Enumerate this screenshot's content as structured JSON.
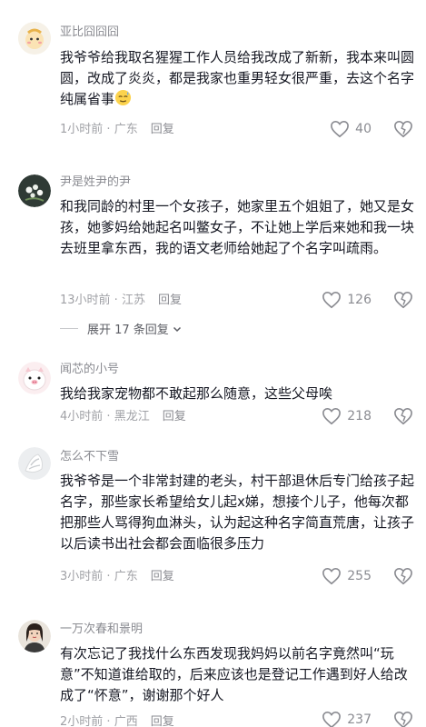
{
  "comments": [
    {
      "username": "亚比囧囧囧",
      "text": "我爷爷给我取名猩猩工作人员给我改成了新新，我本来叫圆圆，改成了炎炎，都是我家也重男轻女很严重，去这个名字纯属省事",
      "emoji": "sweat-smile-emoji",
      "time": "1小时前",
      "location": "广东",
      "reply": "回复",
      "likes": "40"
    },
    {
      "username": "尹是姓尹的尹",
      "text": "和我同龄的村里一个女孩子，她家里五个姐姐了，她又是女孩，她爹妈给她起名叫鳖女子，不让她上学后来她和我一块去班里拿东西，我的语文老师给她起了个名字叫疏雨。",
      "time": "13小时前",
      "location": "江苏",
      "reply": "回复",
      "likes": "126",
      "expand": "展开 17 条回复"
    },
    {
      "username": "闻芯的小号",
      "text": "我给我家宠物都不敢起那么随意，这些父母唉",
      "time": "4小时前",
      "location": "黑龙江",
      "reply": "回复",
      "likes": "218"
    },
    {
      "username": "怎么不下雪",
      "text": "我爷爷是一个非常封建的老头，村干部退休后专门给孩子起名字，那些家长希望给女儿起x娣，想接个儿子，他每次都把那些人骂得狗血淋头，认为起这种名字简直荒唐，让孩子以后读书出社会都会面临很多压力",
      "time": "3小时前",
      "location": "广东",
      "reply": "回复",
      "likes": "255"
    },
    {
      "username": "一万次春和景明",
      "text": "有次忘记了我找什么东西发现我妈妈以前名字竟然叫“玩意”不知道谁给取的，后来应该也是登记工作遇到好人给改成了“怀意”，谢谢那个好人",
      "time": "2小时前",
      "location": "广西",
      "reply": "回复",
      "likes": "237"
    }
  ],
  "separator": " · "
}
